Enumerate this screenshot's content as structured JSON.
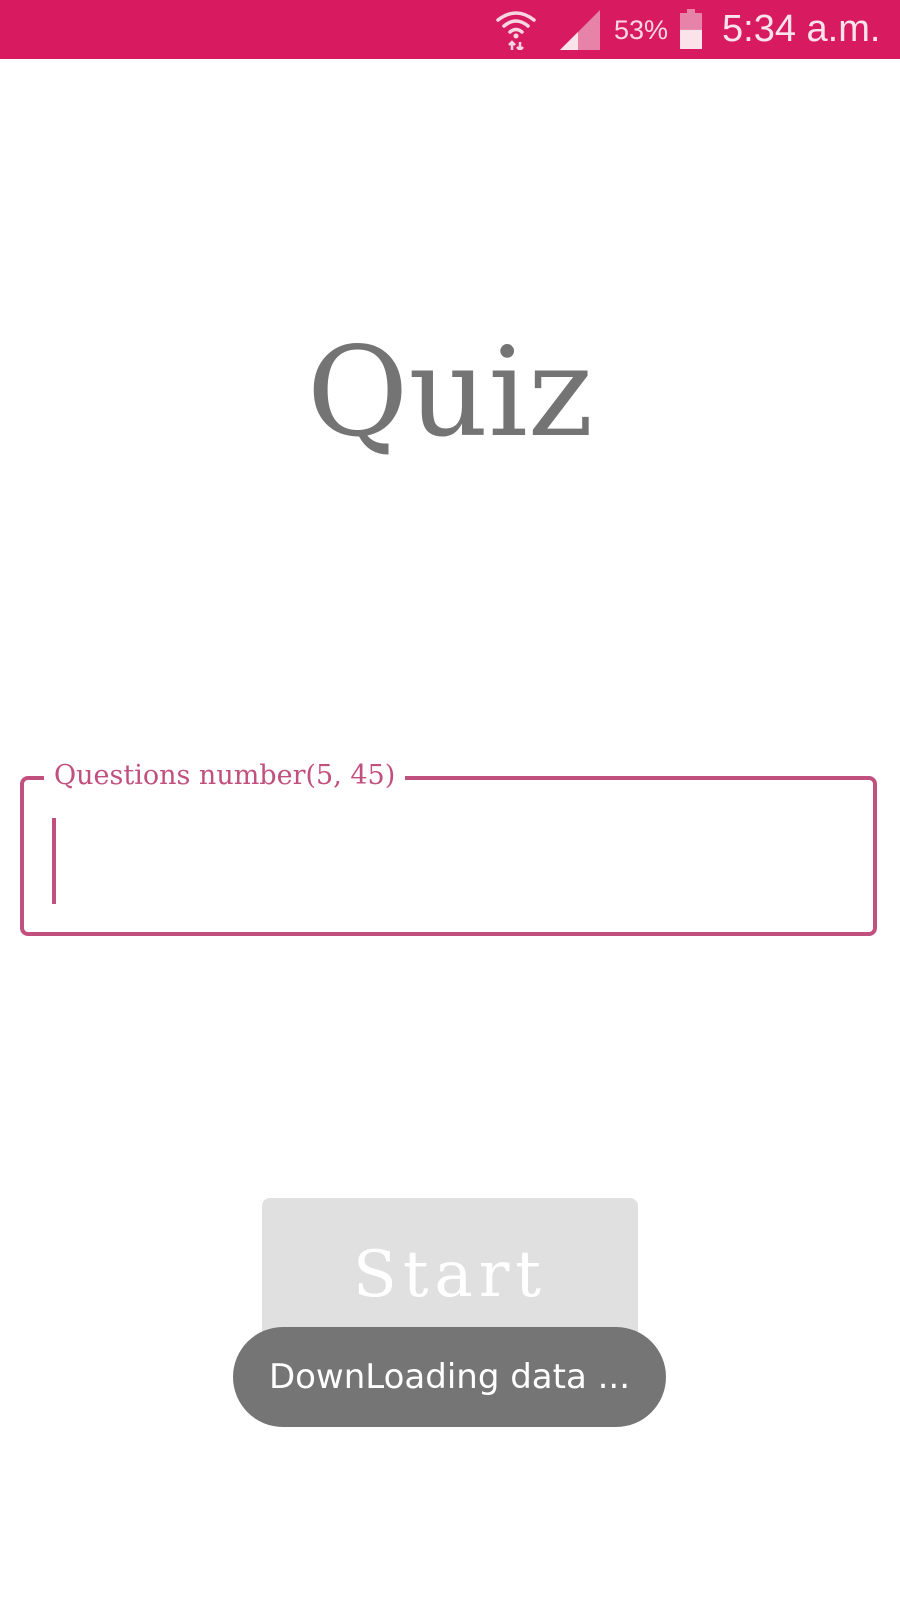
{
  "status_bar": {
    "battery_percent": "53%",
    "time": "5:34 a.m.",
    "battery_level": 0.53,
    "icons": [
      "wifi-icon",
      "cell-signal-icon",
      "battery-icon"
    ],
    "color": "#d81b60"
  },
  "app": {
    "title": "Quiz"
  },
  "questions_field": {
    "label": "Questions number(5, 45)",
    "value": "",
    "accent_color": "#c2507f"
  },
  "start_button": {
    "label": "Start",
    "enabled": false
  },
  "toast": {
    "message": "DownLoading data ..."
  }
}
